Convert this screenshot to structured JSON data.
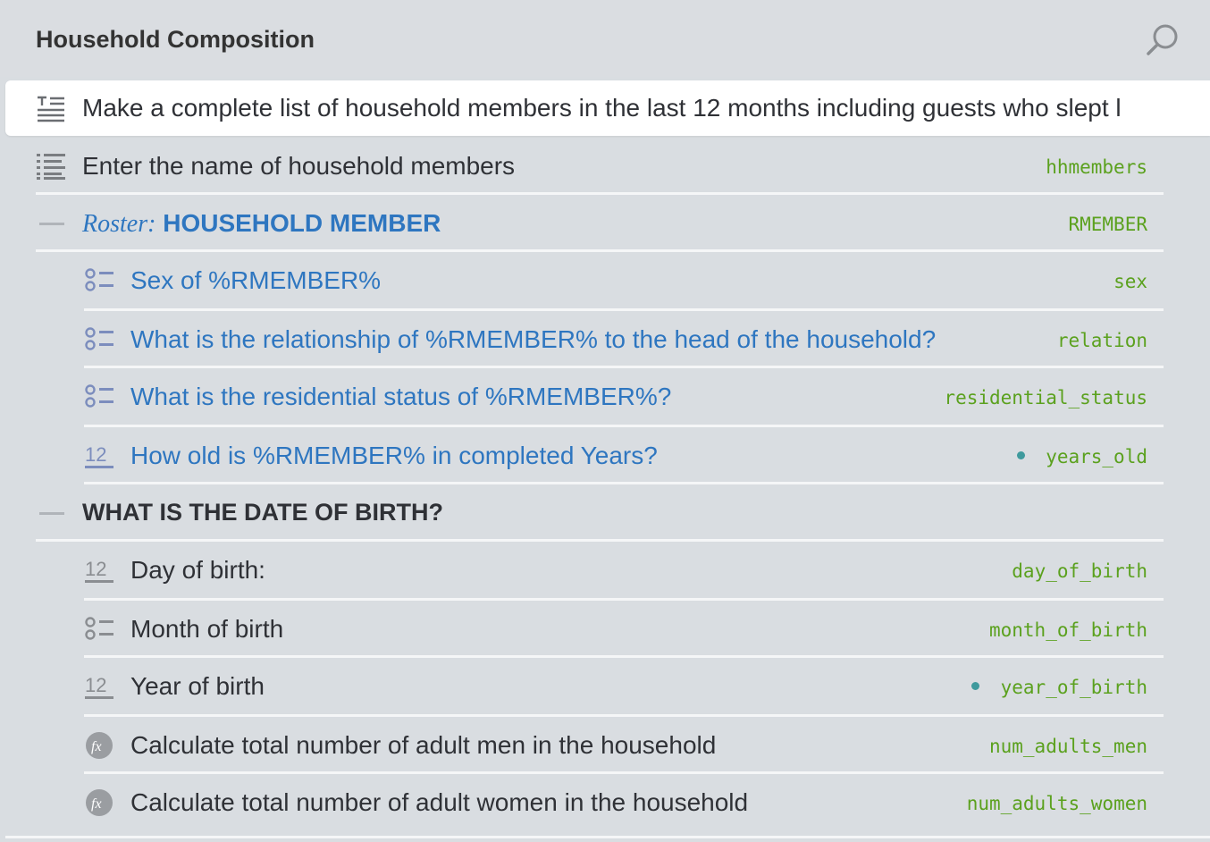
{
  "header": {
    "title": "Household Composition",
    "search_icon": "search-icon"
  },
  "selected_item": {
    "icon": "text-static-icon",
    "text": "Make a complete list of household members in the last 12 months including guests who slept l"
  },
  "list_question": {
    "icon": "list-question-icon",
    "text": "Enter the name of household members",
    "variable": "hhmembers"
  },
  "roster": {
    "prefix": "Roster:",
    "title": "HOUSEHOLD MEMBER",
    "variable": "RMEMBER",
    "items": [
      {
        "icon": "single-select-icon",
        "text": "Sex of %RMEMBER%",
        "variable": "sex"
      },
      {
        "icon": "single-select-icon",
        "text": "What is the relationship of %RMEMBER% to the head of the household?",
        "variable": "relation"
      },
      {
        "icon": "single-select-icon",
        "text": "What is the residential status of %RMEMBER%?",
        "variable": "residential_status"
      },
      {
        "icon": "numeric-icon",
        "text": "How old is %RMEMBER% in completed Years?",
        "variable": "years_old",
        "has_marker": true
      }
    ]
  },
  "group": {
    "title": "WHAT IS THE DATE OF BIRTH?",
    "items": [
      {
        "icon": "numeric-icon",
        "text": "Day of birth:",
        "variable": "day_of_birth"
      },
      {
        "icon": "single-select-icon",
        "text": "Month of birth",
        "variable": "month_of_birth"
      },
      {
        "icon": "numeric-icon",
        "text": "Year of birth",
        "variable": "year_of_birth",
        "has_marker": true
      },
      {
        "icon": "variable-fx-icon",
        "text": "Calculate total number of adult men in the household",
        "variable": "num_adults_men"
      },
      {
        "icon": "variable-fx-icon",
        "text": "Calculate total number of adult women in the household",
        "variable": "num_adults_women"
      }
    ]
  },
  "colors": {
    "background": "#d9dde1",
    "blue_text": "#2e76c0",
    "variable_green": "#5ba11e",
    "marker_teal": "#3f9a9d"
  }
}
